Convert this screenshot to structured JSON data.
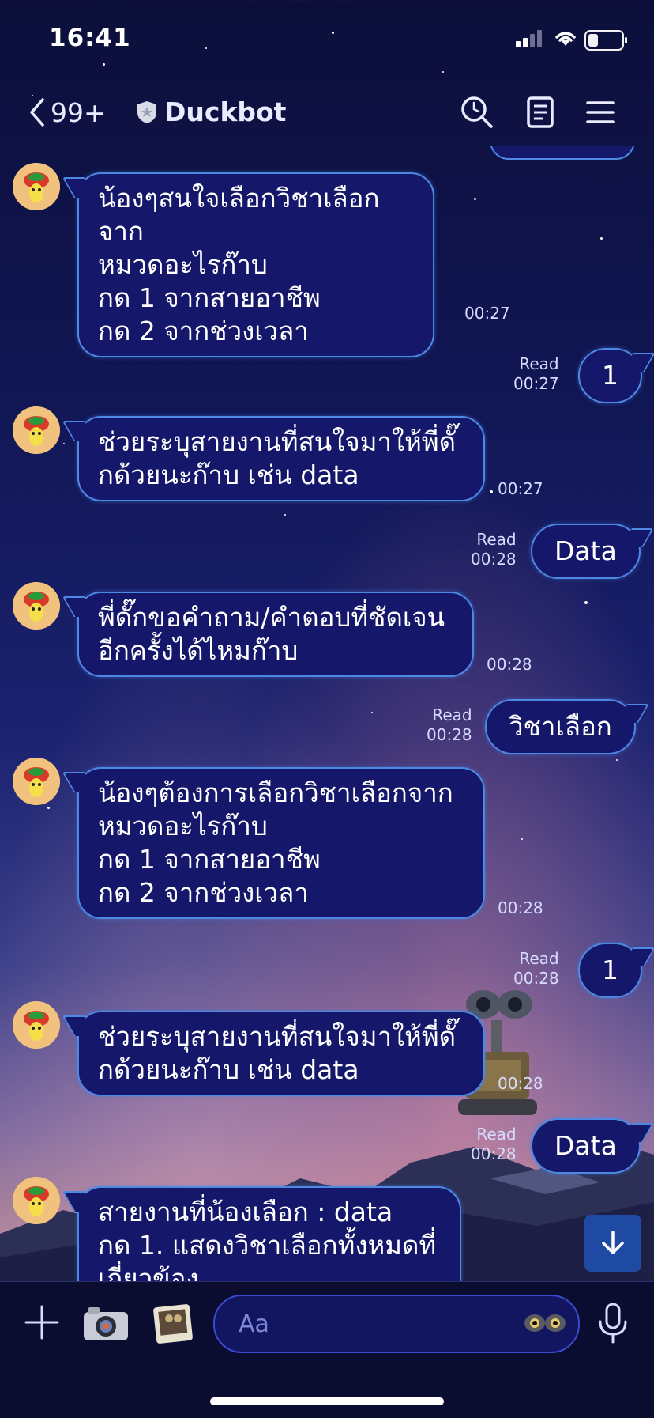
{
  "status_bar": {
    "time": "16:41"
  },
  "header": {
    "back_count": "99+",
    "title": "Duckbot"
  },
  "messages": [
    {
      "dir": "in",
      "lines": [
        "น้องๆสนใจเลือกวิชาเลือกจาก",
        "หมวดอะไรก๊าบ",
        "กด 1 จากสายอาชีพ",
        "กด 2 จากช่วงเวลา"
      ],
      "time": "00:27"
    },
    {
      "dir": "out",
      "text": "1",
      "read": "Read",
      "time": "00:27"
    },
    {
      "dir": "in",
      "lines": [
        "ช่วยระบุสายงานที่สนใจมาให้พี่ดั๊",
        "กด้วยนะก๊าบ เช่น data"
      ],
      "time": "00:27"
    },
    {
      "dir": "out",
      "text": "Data",
      "read": "Read",
      "time": "00:28"
    },
    {
      "dir": "in",
      "lines": [
        "พี่ดั๊กขอคำถาม/คำตอบที่ชัดเจน",
        "อีกครั้งได้ไหมก๊าบ"
      ],
      "time": "00:28"
    },
    {
      "dir": "out",
      "text": "วิชาเลือก",
      "read": "Read",
      "time": "00:28"
    },
    {
      "dir": "in",
      "lines": [
        "น้องๆต้องการเลือกวิชาเลือกจาก",
        "หมวดอะไรก๊าบ",
        "กด 1 จากสายอาชีพ",
        "กด 2 จากช่วงเวลา"
      ],
      "time": "00:28"
    },
    {
      "dir": "out",
      "text": "1",
      "read": "Read",
      "time": "00:28"
    },
    {
      "dir": "in",
      "lines": [
        "ช่วยระบุสายงานที่สนใจมาให้พี่ดั๊",
        "กด้วยนะก๊าบ เช่น data"
      ],
      "time": "00:28"
    },
    {
      "dir": "out",
      "text": "Data",
      "read": "Read",
      "time": "00:28"
    },
    {
      "dir": "in",
      "lines": [
        "สายงานที่น้องเลือก : data",
        "กด 1. แสดงวิชาเลือกทั้งหมดที่",
        "เกี่ยวข้อง"
      ],
      "time": ""
    }
  ],
  "input": {
    "placeholder": "Aa"
  },
  "colors": {
    "bubble": "#14176a",
    "bubble_border": "#4d88e3",
    "accent": "#1f4aa3"
  }
}
